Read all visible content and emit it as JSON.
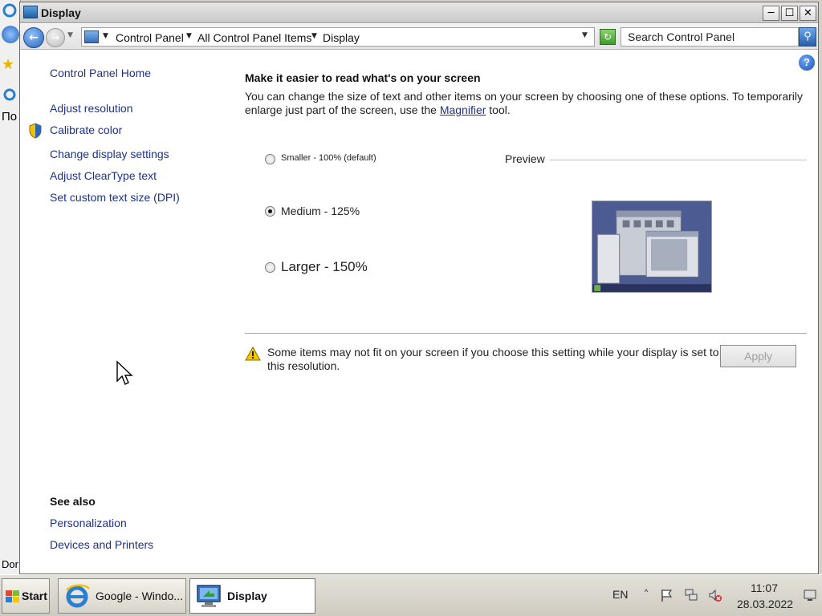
{
  "background_window": {
    "text_1": "По",
    "text_2": "Dor"
  },
  "window": {
    "title": "Display",
    "min_glyph": "─",
    "max_glyph": "☐",
    "close_glyph": "✕"
  },
  "addressbar": {
    "back_glyph": "←",
    "forward_glyph": "→",
    "breadcrumbs": [
      "Control Panel",
      "All Control Panel Items",
      "Display"
    ],
    "search_placeholder": "Search Control Panel",
    "refresh_glyph": "↻",
    "search_glyph": "⚲"
  },
  "help": {
    "glyph": "?"
  },
  "sidebar": {
    "home": "Control Panel Home",
    "links": [
      "Adjust resolution",
      "Calibrate color",
      "Change display settings",
      "Adjust ClearType text",
      "Set custom text size (DPI)"
    ],
    "see_also_title": "See also",
    "see_also": [
      "Personalization",
      "Devices and Printers"
    ]
  },
  "main": {
    "heading": "Make it easier to read what's on your screen",
    "description_1": "You can change the size of text and other items on your screen by choosing one of these options. To temporarily enlarge just part of the screen, use the ",
    "description_link": "Magnifier",
    "description_2": " tool.",
    "options": [
      {
        "label": "Smaller - 100% (default)",
        "checked": false
      },
      {
        "label": "Medium - 125%",
        "checked": true
      },
      {
        "label": "Larger - 150%",
        "checked": false
      }
    ],
    "preview_label": "Preview",
    "warning": "Some items may not fit on your screen if you choose this setting while your display is set to this resolution.",
    "apply_label": "Apply"
  },
  "taskbar": {
    "start_label": "Start",
    "tasks": [
      {
        "label": "Google - Windo...",
        "active": false
      },
      {
        "label": "Display",
        "active": true
      }
    ],
    "language": "EN",
    "time": "11:07",
    "date": "28.03.2022"
  },
  "colors": {
    "link": "#1e3287",
    "accent": "#2a66b8"
  }
}
